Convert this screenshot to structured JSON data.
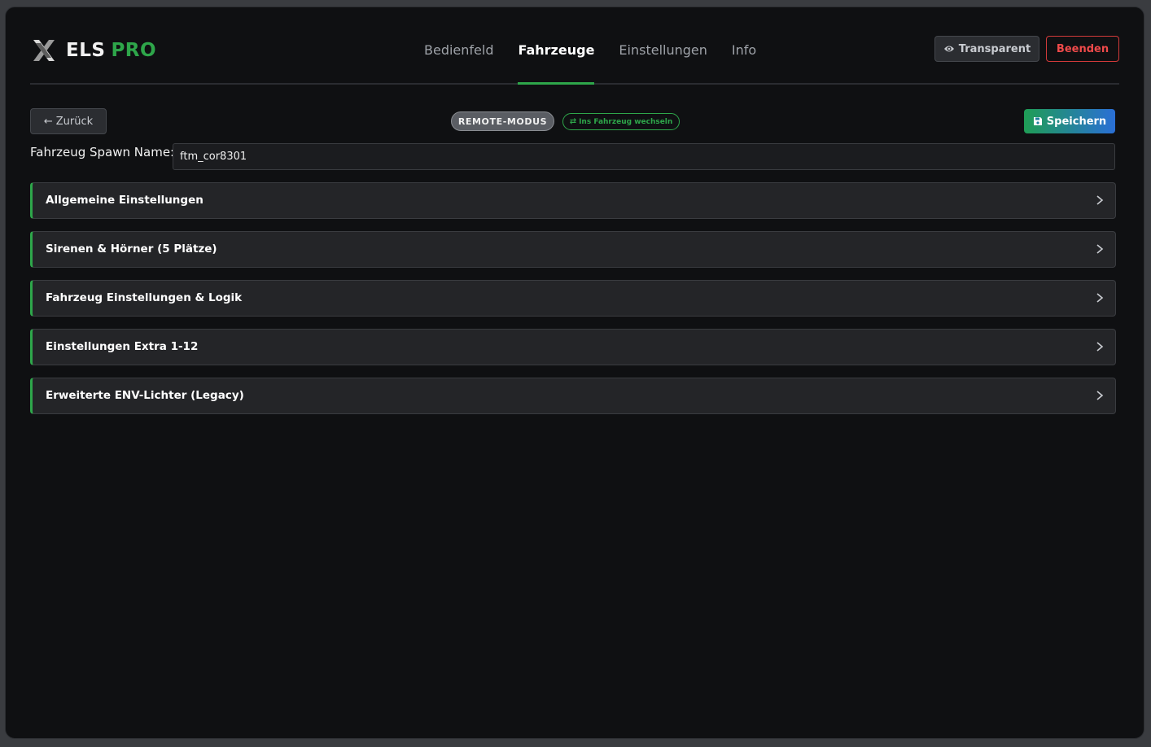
{
  "app": {
    "brand_main": "ELS",
    "brand_accent": "PRO",
    "logo_icon": "x-logo-icon"
  },
  "nav": {
    "tabs": [
      {
        "label": "Bedienfeld",
        "active": false
      },
      {
        "label": "Fahrzeuge",
        "active": true
      },
      {
        "label": "Einstellungen",
        "active": false
      },
      {
        "label": "Info",
        "active": false
      }
    ]
  },
  "header_buttons": {
    "transparent_label": "Transparent",
    "transparent_icon": "eye-icon",
    "quit_label": "Beenden"
  },
  "toolbar": {
    "back_label": "Zurück",
    "back_icon": "arrow-left-icon",
    "mode_badge": "REMOTE-MODUS",
    "switch_label": "Ins Fahrzeug wechseln",
    "switch_icon": "swap-arrows-icon",
    "save_label": "Speichern",
    "save_icon": "floppy-disk-icon"
  },
  "spawn": {
    "label": "Fahrzeug Spawn Name:",
    "value": "ftm_cor8301"
  },
  "sections": [
    {
      "title": "Allgemeine Einstellungen"
    },
    {
      "title": "Sirenen & Hörner (5 Plätze)"
    },
    {
      "title": "Fahrzeug Einstellungen & Logik"
    },
    {
      "title": "Einstellungen Extra 1-12"
    },
    {
      "title": "Erweiterte ENV-Lichter (Legacy)"
    }
  ],
  "colors": {
    "accent_green": "#2ea64a",
    "danger_red": "#ef4a4a",
    "background": "#0f1012",
    "panel": "#242528"
  }
}
